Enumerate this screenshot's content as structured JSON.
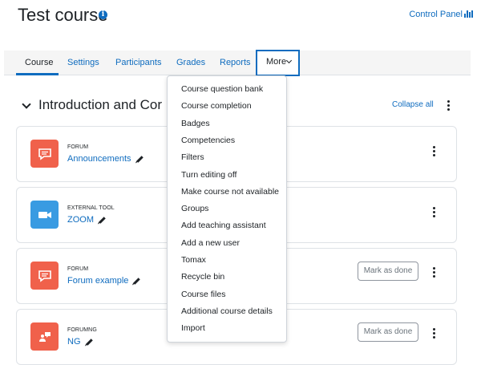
{
  "page": {
    "title": "Test course",
    "control_panel_label": "Control Panel"
  },
  "nav": {
    "items": [
      {
        "label": "Course"
      },
      {
        "label": "Settings"
      },
      {
        "label": "Participants"
      },
      {
        "label": "Grades"
      },
      {
        "label": "Reports"
      }
    ],
    "more_label": "More",
    "active": "Course"
  },
  "section": {
    "title": "Introduction and Cor",
    "collapse_all_label": "Collapse all"
  },
  "activities": [
    {
      "type": "FORUM",
      "name": "Announcements",
      "icon": "forum-icon",
      "icon_color": "#f0614b",
      "mark_as_done": null
    },
    {
      "type": "EXTERNAL TOOL",
      "name": "ZOOM",
      "icon": "video-camera-icon",
      "icon_color": "#399be2",
      "mark_as_done": null
    },
    {
      "type": "FORUM",
      "name": "Forum example",
      "icon": "forum-icon",
      "icon_color": "#f0614b",
      "mark_as_done": "Mark as done"
    },
    {
      "type": "FORUMNG",
      "name": "NG",
      "icon": "forumng-icon",
      "icon_color": "#f0614b",
      "mark_as_done": "Mark as done"
    }
  ],
  "more_menu": {
    "items": [
      "Course question bank",
      "Course completion",
      "Badges",
      "Competencies",
      "Filters",
      "Turn editing off",
      "Make course not available",
      "Groups",
      "Add teaching assistant",
      "Add a new user",
      "Tomax",
      "Recycle bin",
      "Course files",
      "Additional course details",
      "Import"
    ]
  },
  "colors": {
    "link": "#0f6cbf",
    "text": "#1d2125",
    "forum": "#f0614b",
    "external_tool": "#399be2"
  }
}
